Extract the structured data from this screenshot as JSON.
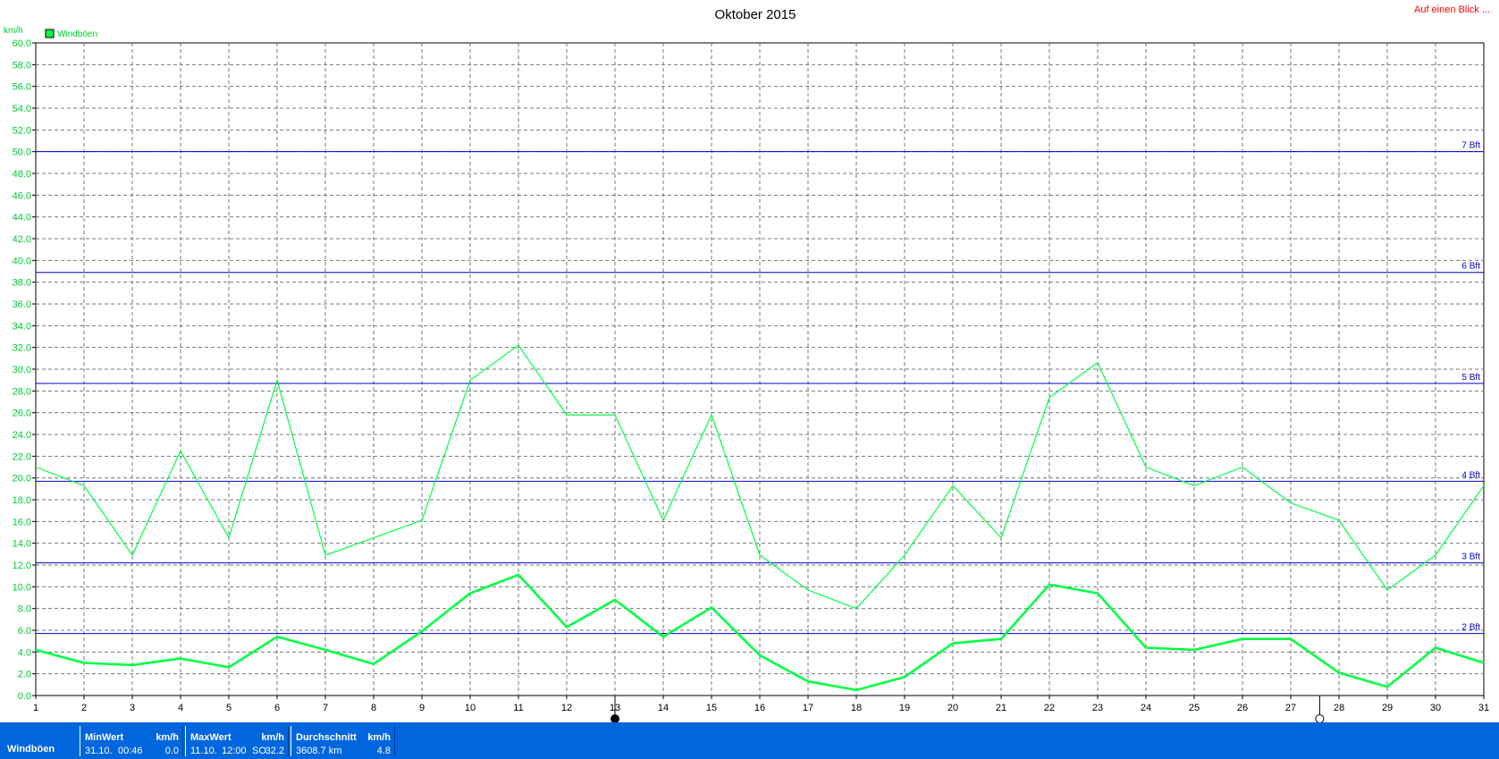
{
  "chart_data": {
    "type": "line",
    "title": "Oktober 2015",
    "ylabel": "km/h",
    "ylim": [
      0,
      60
    ],
    "yticks": [
      "0.0",
      "2.0",
      "4.0",
      "6.0",
      "8.0",
      "10.0",
      "12.0",
      "14.0",
      "16.0",
      "18.0",
      "20.0",
      "22.0",
      "24.0",
      "26.0",
      "28.0",
      "30.0",
      "32.0",
      "34.0",
      "36.0",
      "38.0",
      "40.0",
      "42.0",
      "44.0",
      "46.0",
      "48.0",
      "50.0",
      "52.0",
      "54.0",
      "56.0",
      "58.0",
      "60.0"
    ],
    "x": [
      "1",
      "2",
      "3",
      "4",
      "5",
      "6",
      "7",
      "8",
      "9",
      "10",
      "11",
      "12",
      "13",
      "14",
      "15",
      "16",
      "17",
      "18",
      "19",
      "20",
      "21",
      "22",
      "23",
      "24",
      "25",
      "26",
      "27",
      "28",
      "29",
      "30",
      "31"
    ],
    "legend": "top-left",
    "grid": true,
    "series": [
      {
        "name": "Windböen",
        "color": "#00ff44",
        "values": [
          21.0,
          19.3,
          12.9,
          22.5,
          14.5,
          29.0,
          12.9,
          14.5,
          16.1,
          29.0,
          32.2,
          25.8,
          25.8,
          16.1,
          25.8,
          12.9,
          9.7,
          8.0,
          12.9,
          19.3,
          14.5,
          27.4,
          30.6,
          21.0,
          19.3,
          21.0,
          17.7,
          16.1,
          9.7,
          12.9,
          19.3
        ]
      },
      {
        "color": "#00ff44",
        "values": [
          4.2,
          3.0,
          2.8,
          3.4,
          2.6,
          5.4,
          4.2,
          2.9,
          5.9,
          9.4,
          11.1,
          6.3,
          8.8,
          5.4,
          8.1,
          3.7,
          1.3,
          0.5,
          1.7,
          4.8,
          5.2,
          10.2,
          9.4,
          4.4,
          4.2,
          5.2,
          5.2,
          2.1,
          0.8,
          4.4,
          3.0
        ]
      }
    ],
    "beaufort_lines": [
      {
        "label": "2 Bft",
        "value": 5.7
      },
      {
        "label": "3 Bft",
        "value": 12.2
      },
      {
        "label": "4 Bft",
        "value": 19.7
      },
      {
        "label": "5 Bft",
        "value": 28.7
      },
      {
        "label": "6 Bft",
        "value": 38.9
      },
      {
        "label": "7 Bft",
        "value": 50.0
      }
    ],
    "markers": [
      {
        "type": "new-moon-icon",
        "x": 13
      },
      {
        "type": "full-moon-icon",
        "x": 27.6
      }
    ]
  },
  "link_text": "Auf einen Blick ...",
  "stats": {
    "series_label": "Windböen",
    "min": {
      "header": "MinWert",
      "unit": "km/h",
      "date": "31.10.",
      "time": "00:46",
      "value": "0.0"
    },
    "max": {
      "header": "MaxWert",
      "unit": "km/h",
      "date": "11.10.",
      "time": "12:00",
      "dir": "SO",
      "value": "32.2"
    },
    "avg": {
      "header": "Durchschnitt",
      "unit": "km/h",
      "distance": "3608.7 km",
      "value": "4.8"
    }
  },
  "colors": {
    "series": "#00ff44",
    "beaufort": "#0000cc",
    "statbar": "#0066dd",
    "link": "#ff0000"
  }
}
